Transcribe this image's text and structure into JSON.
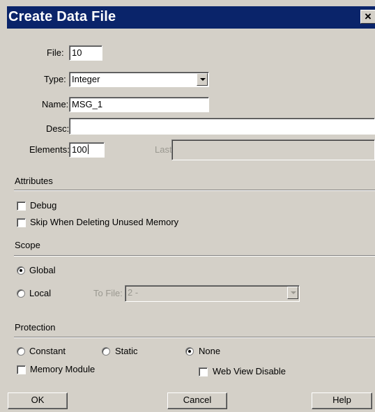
{
  "window": {
    "title": "Create Data File",
    "close_glyph": "×"
  },
  "file": {
    "label": "File:",
    "value": "10"
  },
  "type": {
    "label": "Type:",
    "value": "Integer"
  },
  "name": {
    "label": "Name:",
    "value": "MSG_1"
  },
  "desc": {
    "label": "Desc:",
    "value": ""
  },
  "elements": {
    "label": "Elements:",
    "value": "100"
  },
  "last": {
    "label": "Last:",
    "value": ""
  },
  "attributes": {
    "title": "Attributes",
    "debug": {
      "label": "Debug",
      "checked": false
    },
    "skip": {
      "label": "Skip When Deleting Unused Memory",
      "checked": false
    }
  },
  "scope": {
    "title": "Scope",
    "global": {
      "label": "Global",
      "selected": true
    },
    "local": {
      "label": "Local",
      "selected": false
    },
    "to_file": {
      "label": "To File:",
      "value": "2 -"
    }
  },
  "protection": {
    "title": "Protection",
    "constant": {
      "label": "Constant",
      "selected": false
    },
    "static": {
      "label": "Static",
      "selected": false
    },
    "none": {
      "label": "None",
      "selected": true
    },
    "memory_module": {
      "label": "Memory Module",
      "checked": false
    },
    "web_view_disable": {
      "label": "Web View Disable",
      "checked": false
    }
  },
  "buttons": {
    "ok": "OK",
    "cancel": "Cancel",
    "help": "Help"
  },
  "colors": {
    "titlebar": "#0a246a",
    "face": "#d4d0c8",
    "disabled_text": "#9a9890"
  }
}
